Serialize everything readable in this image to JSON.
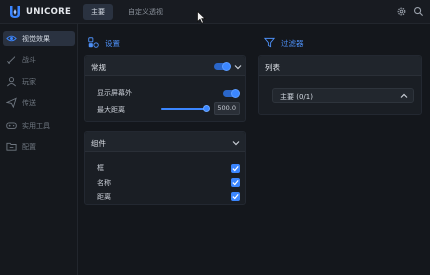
{
  "app": {
    "logo_text": "UNICORE"
  },
  "topbar": {
    "tabs": [
      {
        "label": "主要",
        "active": true
      },
      {
        "label": "自定义透视",
        "active": false
      }
    ],
    "icons": [
      "gear-icon",
      "search-icon"
    ]
  },
  "sidebar": {
    "items": [
      {
        "label": "视觉效果",
        "icon": "eye-icon",
        "active": true
      },
      {
        "label": "战斗",
        "icon": "sword-icon",
        "active": false
      },
      {
        "label": "玩家",
        "icon": "user-icon",
        "active": false
      },
      {
        "label": "传送",
        "icon": "send-icon",
        "active": false
      },
      {
        "label": "实用工具",
        "icon": "gamepad-icon",
        "active": false
      },
      {
        "label": "配置",
        "icon": "folder-icon",
        "active": false
      }
    ]
  },
  "settings": {
    "title": "设置",
    "general": {
      "title": "常规",
      "enabled": true,
      "show_offscreen_label": "显示屏幕外",
      "show_offscreen": true,
      "max_distance_label": "最大距离",
      "max_distance_value": "500.0",
      "max_distance_fraction": 1.0
    },
    "components": {
      "title": "组件",
      "items": [
        {
          "label": "框",
          "checked": true
        },
        {
          "label": "名称",
          "checked": true
        },
        {
          "label": "距离",
          "checked": true
        }
      ]
    }
  },
  "filter": {
    "title": "过滤器",
    "list": {
      "title": "列表",
      "selected": "主要 (0/1)"
    }
  },
  "colors": {
    "accent": "#3b86ff",
    "background": "#14171c",
    "panel": "#1a1e24"
  }
}
